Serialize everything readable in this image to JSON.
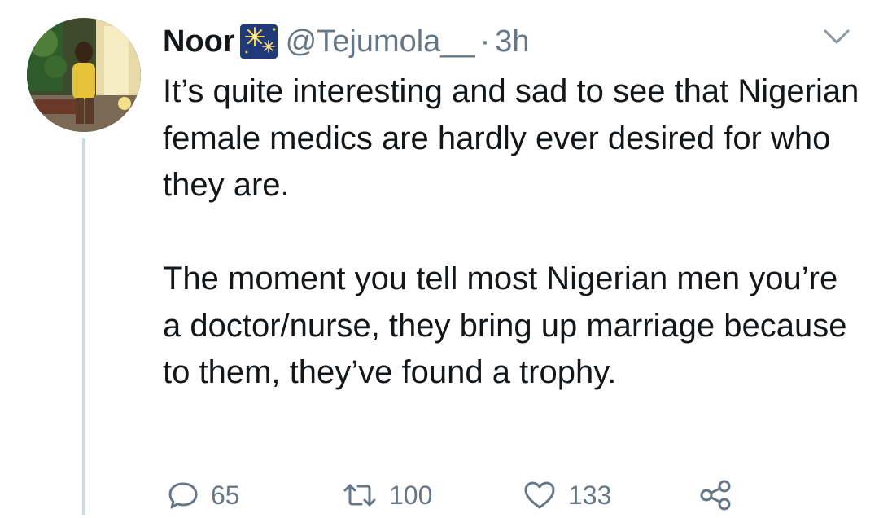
{
  "tweet": {
    "author_name": "Noor",
    "author_handle": "@Tejumola__",
    "separator": "·",
    "timestamp": "3h",
    "paragraphs": [
      "It’s quite interesting and sad to see that Nigerian female medics are hardly ever desired for who they are.",
      "The moment you tell most Nigerian men you’re a doctor/nurse, they bring up marriage because to them, they’ve found a trophy."
    ],
    "replies": "65",
    "retweets": "100",
    "likes": "133"
  },
  "icons": {
    "badge": "fireworks-emoji-icon",
    "menu": "chevron-down-icon",
    "reply": "reply-icon",
    "retweet": "retweet-icon",
    "like": "heart-icon",
    "share": "share-icon"
  },
  "colors": {
    "text": "#14171a",
    "secondary": "#657786",
    "thread_line": "#cfd9de"
  }
}
